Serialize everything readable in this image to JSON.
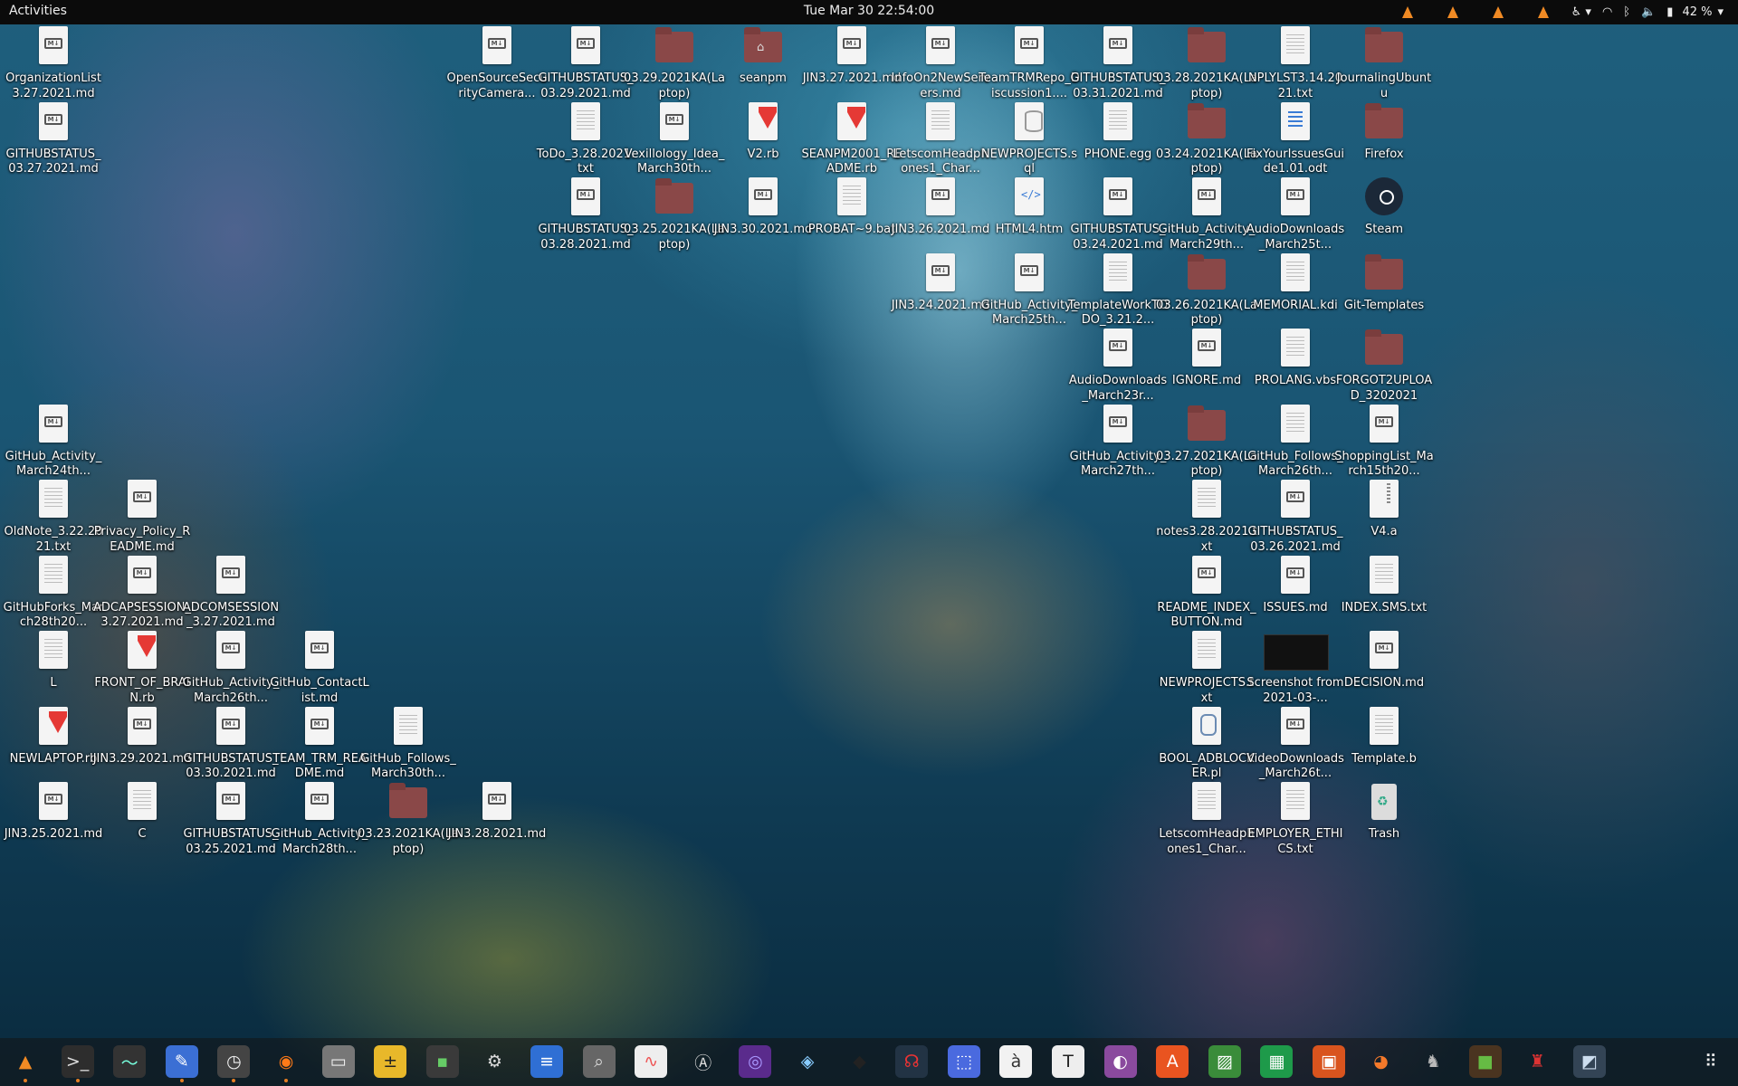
{
  "topbar": {
    "activities": "Activities",
    "clock": "Tue Mar 30  22:54:00",
    "battery": "42 %"
  },
  "icons": [
    {
      "label": "OrganizationList3.27.2021.md",
      "type": "md",
      "col": 0,
      "row": 0
    },
    {
      "label": "GITHUBSTATUS_03.27.2021.md",
      "type": "md",
      "col": 0,
      "row": 1
    },
    {
      "label": "GitHub_Activity_March24th...",
      "type": "md",
      "col": 0,
      "row": 5
    },
    {
      "label": "OldNote_3.22.2021.txt",
      "type": "txt",
      "col": 0,
      "row": 6
    },
    {
      "label": "GitHubForks_March28th20...",
      "type": "txt",
      "col": 0,
      "row": 7
    },
    {
      "label": "L",
      "type": "txt",
      "col": 0,
      "row": 8
    },
    {
      "label": "NEWLAPTOP.rb",
      "type": "rb",
      "col": 0,
      "row": 9
    },
    {
      "label": "JIN3.25.2021.md",
      "type": "md",
      "col": 0,
      "row": 10
    },
    {
      "label": "Privacy_Policy_README.md",
      "type": "md",
      "col": 1,
      "row": 6
    },
    {
      "label": "ADCAPSESSION_3.27.2021.md",
      "type": "md",
      "col": 1,
      "row": 7
    },
    {
      "label": "FRONT_OF_BRAIN.rb",
      "type": "rb",
      "col": 1,
      "row": 8
    },
    {
      "label": "JIN3.29.2021.md",
      "type": "md",
      "col": 1,
      "row": 9
    },
    {
      "label": "C",
      "type": "txt",
      "col": 1,
      "row": 10
    },
    {
      "label": "ADCOMSESSION_3.27.2021.md",
      "type": "md",
      "col": 2,
      "row": 7
    },
    {
      "label": "GitHub_Activity_March26th...",
      "type": "md",
      "col": 2,
      "row": 8
    },
    {
      "label": "GITHUBSTATUS_03.30.2021.md",
      "type": "md",
      "col": 2,
      "row": 9
    },
    {
      "label": "GITHUBSTATUS_03.25.2021.md",
      "type": "md",
      "col": 2,
      "row": 10
    },
    {
      "label": "GitHub_ContactList.md",
      "type": "md",
      "col": 3,
      "row": 8
    },
    {
      "label": "TEAM_TRM_README.md",
      "type": "md",
      "col": 3,
      "row": 9
    },
    {
      "label": "GitHub_Activity_March28th...",
      "type": "md",
      "col": 3,
      "row": 10
    },
    {
      "label": "GitHub_Follows_March30th...",
      "type": "txt",
      "col": 4,
      "row": 9
    },
    {
      "label": "03.23.2021KA(Laptop)",
      "type": "folder",
      "col": 4,
      "row": 10
    },
    {
      "label": "OpenSourceSecurityCamera...",
      "type": "md",
      "col": 5,
      "row": 0
    },
    {
      "label": "JIN3.28.2021.md",
      "type": "md",
      "col": 5,
      "row": 10
    },
    {
      "label": "GITHUBSTATUS_03.29.2021.md",
      "type": "md",
      "col": 6,
      "row": 0
    },
    {
      "label": "ToDo_3.28.2021.txt",
      "type": "txt",
      "col": 6,
      "row": 1
    },
    {
      "label": "GITHUBSTATUS_03.28.2021.md",
      "type": "md",
      "col": 6,
      "row": 2
    },
    {
      "label": "03.29.2021KA(Laptop)",
      "type": "folder",
      "col": 7,
      "row": 0
    },
    {
      "label": "Vexillology_Idea_March30th...",
      "type": "md",
      "col": 7,
      "row": 1
    },
    {
      "label": "03.25.2021KA(Laptop)",
      "type": "folder",
      "col": 7,
      "row": 2
    },
    {
      "label": "seanpm",
      "type": "home",
      "col": 8,
      "row": 0
    },
    {
      "label": "V2.rb",
      "type": "rb",
      "col": 8,
      "row": 1
    },
    {
      "label": "JIN3.30.2021.md",
      "type": "md",
      "col": 8,
      "row": 2
    },
    {
      "label": "JIN3.27.2021.md",
      "type": "md",
      "col": 9,
      "row": 0
    },
    {
      "label": "SEANPM2001_README.rb",
      "type": "rb",
      "col": 9,
      "row": 1
    },
    {
      "label": "PROBAT~9.bat",
      "type": "txt",
      "col": 9,
      "row": 2
    },
    {
      "label": "InfoOn2NewServers.md",
      "type": "md",
      "col": 10,
      "row": 0
    },
    {
      "label": "LetscomHeadphones1_Char...",
      "type": "txt",
      "col": 10,
      "row": 1
    },
    {
      "label": "JIN3.26.2021.md",
      "type": "md",
      "col": 10,
      "row": 2
    },
    {
      "label": "JIN3.24.2021.md",
      "type": "md",
      "col": 10,
      "row": 3
    },
    {
      "label": "TeamTRMRepo_Discussion1....",
      "type": "md",
      "col": 11,
      "row": 0
    },
    {
      "label": "NEWPROJECTS.sql",
      "type": "sql",
      "col": 11,
      "row": 1
    },
    {
      "label": "HTML4.htm",
      "type": "html",
      "col": 11,
      "row": 2
    },
    {
      "label": "GitHub_Activity_March25th...",
      "type": "md",
      "col": 11,
      "row": 3
    },
    {
      "label": "GITHUBSTATUS_03.31.2021.md",
      "type": "md",
      "col": 12,
      "row": 0
    },
    {
      "label": "PHONE.egg",
      "type": "txt",
      "col": 12,
      "row": 1
    },
    {
      "label": "GITHUBSTATUS_03.24.2021.md",
      "type": "md",
      "col": 12,
      "row": 2
    },
    {
      "label": "TemplateWorkTODO_3.21.2...",
      "type": "txt",
      "col": 12,
      "row": 3
    },
    {
      "label": "AudioDownloads_March23r...",
      "type": "md",
      "col": 12,
      "row": 4
    },
    {
      "label": "GitHub_Activity_March27th...",
      "type": "md",
      "col": 12,
      "row": 5
    },
    {
      "label": "03.28.2021KA(Laptop)",
      "type": "folder",
      "col": 13,
      "row": 0
    },
    {
      "label": "03.24.2021KA(Laptop)",
      "type": "folder",
      "col": 13,
      "row": 1
    },
    {
      "label": "GitHub_Activity_March29th...",
      "type": "md",
      "col": 13,
      "row": 2
    },
    {
      "label": "03.26.2021KA(Laptop)",
      "type": "folder",
      "col": 13,
      "row": 3
    },
    {
      "label": "IGNORE.md",
      "type": "md",
      "col": 13,
      "row": 4
    },
    {
      "label": "03.27.2021KA(Laptop)",
      "type": "folder",
      "col": 13,
      "row": 5
    },
    {
      "label": "notes3.28.2021.txt",
      "type": "txt",
      "col": 13,
      "row": 6
    },
    {
      "label": "README_INDEX_BUTTON.md",
      "type": "md",
      "col": 13,
      "row": 7
    },
    {
      "label": "NEWPROJECTS.txt",
      "type": "txt",
      "col": 13,
      "row": 8
    },
    {
      "label": "BOOL_ADBLOCKER.pl",
      "type": "pl",
      "col": 13,
      "row": 9
    },
    {
      "label": "LetscomHeadphones1_Char...",
      "type": "txt",
      "col": 13,
      "row": 10
    },
    {
      "label": "NPLYLST3.14.2021.txt",
      "type": "txt",
      "col": 14,
      "row": 0
    },
    {
      "label": "FixYourIssuesGuide1.01.odt",
      "type": "odt",
      "col": 14,
      "row": 1
    },
    {
      "label": "AudioDownloads_March25t...",
      "type": "md",
      "col": 14,
      "row": 2
    },
    {
      "label": "MEMORIAL.kdi",
      "type": "txt",
      "col": 14,
      "row": 3
    },
    {
      "label": "PROLANG.vbs",
      "type": "txt",
      "col": 14,
      "row": 4
    },
    {
      "label": "GitHub_Follows_March26th...",
      "type": "txt",
      "col": 14,
      "row": 5
    },
    {
      "label": "GITHUBSTATUS_03.26.2021.md",
      "type": "md",
      "col": 14,
      "row": 6
    },
    {
      "label": "ISSUES.md",
      "type": "md",
      "col": 14,
      "row": 7
    },
    {
      "label": "Screenshot from 2021-03-...",
      "type": "shot",
      "col": 14,
      "row": 8
    },
    {
      "label": "VideoDownloads_March26t...",
      "type": "md",
      "col": 14,
      "row": 9
    },
    {
      "label": "EMPLOYER_ETHICS.txt",
      "type": "txt",
      "col": 14,
      "row": 10
    },
    {
      "label": "JournalingUbuntu",
      "type": "folder",
      "col": 15,
      "row": 0
    },
    {
      "label": "Firefox",
      "type": "folder",
      "col": 15,
      "row": 1
    },
    {
      "label": "Steam",
      "type": "steam",
      "col": 15,
      "row": 2
    },
    {
      "label": "Git-Templates",
      "type": "folder",
      "col": 15,
      "row": 3
    },
    {
      "label": "FORGOT2UPLOAD_3202021",
      "type": "folder",
      "col": 15,
      "row": 4
    },
    {
      "label": "ShoppingList_March15th20...",
      "type": "md",
      "col": 15,
      "row": 5
    },
    {
      "label": "V4.a",
      "type": "zip",
      "col": 15,
      "row": 6
    },
    {
      "label": "INDEX.SMS.txt",
      "type": "txt",
      "col": 15,
      "row": 7
    },
    {
      "label": "DECISION.md",
      "type": "md",
      "col": 15,
      "row": 8
    },
    {
      "label": "Template.b",
      "type": "txt",
      "col": 15,
      "row": 9
    },
    {
      "label": "Trash",
      "type": "trash",
      "col": 15,
      "row": 10
    }
  ],
  "dock": [
    {
      "name": "vlc-icon",
      "glyph": "▲",
      "color": "#f08a24",
      "bg": "transparent",
      "running": true
    },
    {
      "name": "terminal-icon",
      "glyph": ">_",
      "color": "#ddd",
      "bg": "#2d2d2d",
      "running": true
    },
    {
      "name": "system-monitor-icon",
      "glyph": "〜",
      "color": "#7fd",
      "bg": "#333",
      "running": false
    },
    {
      "name": "text-editor-icon",
      "glyph": "✎",
      "color": "#fff",
      "bg": "#3b6fd4",
      "running": true
    },
    {
      "name": "clock-icon",
      "glyph": "◷",
      "color": "#eee",
      "bg": "#444",
      "running": true
    },
    {
      "name": "firefox-icon",
      "glyph": "◉",
      "color": "#ff7a18",
      "bg": "transparent",
      "running": true
    },
    {
      "name": "files-icon",
      "glyph": "▭",
      "color": "#eee",
      "bg": "#777",
      "running": false
    },
    {
      "name": "calculator-icon",
      "glyph": "±",
      "color": "#222",
      "bg": "#e8b82a",
      "running": false
    },
    {
      "name": "gnome-terminal-green-icon",
      "glyph": "▪",
      "color": "#6c6",
      "bg": "#3a3a3a",
      "running": false
    },
    {
      "name": "settings-icon",
      "glyph": "⚙",
      "color": "#ddd",
      "bg": "transparent",
      "running": false
    },
    {
      "name": "writer-icon",
      "glyph": "≡",
      "color": "#fff",
      "bg": "#2f6fd4",
      "running": false
    },
    {
      "name": "image-viewer-icon",
      "glyph": "⌕",
      "color": "#ddd",
      "bg": "#666",
      "running": false
    },
    {
      "name": "sound-recorder-icon",
      "glyph": "∿",
      "color": "#e55",
      "bg": "#eee",
      "running": false
    },
    {
      "name": "software-updater-icon",
      "glyph": "Ⓐ",
      "color": "#ddd",
      "bg": "transparent",
      "running": false
    },
    {
      "name": "cheese-icon",
      "glyph": "◎",
      "color": "#a9f",
      "bg": "#5a2b8c",
      "running": false
    },
    {
      "name": "virtualbox-icon",
      "glyph": "◈",
      "color": "#8cf",
      "bg": "transparent",
      "running": false
    },
    {
      "name": "inkscape-icon",
      "glyph": "◆",
      "color": "#222",
      "bg": "transparent",
      "running": false
    },
    {
      "name": "headphones-icon",
      "glyph": "☊",
      "color": "#e33",
      "bg": "#234",
      "running": false
    },
    {
      "name": "screenshot-icon",
      "glyph": "⬚",
      "color": "#fff",
      "bg": "#4a6adf",
      "running": false
    },
    {
      "name": "character-map-icon",
      "glyph": "à",
      "color": "#333",
      "bg": "#f2f2f2",
      "running": false
    },
    {
      "name": "typora-icon",
      "glyph": "T",
      "color": "#222",
      "bg": "#eee",
      "running": false
    },
    {
      "name": "tweaks-icon",
      "glyph": "◐",
      "color": "#fff",
      "bg": "#8a4a9e",
      "running": false
    },
    {
      "name": "software-center-icon",
      "glyph": "A",
      "color": "#fff",
      "bg": "#e95420",
      "running": false
    },
    {
      "name": "shotwell-icon",
      "glyph": "▨",
      "color": "#fff",
      "bg": "#3a8c3a",
      "running": false
    },
    {
      "name": "calc-icon",
      "glyph": "▦",
      "color": "#fff",
      "bg": "#1e9a4a",
      "running": false
    },
    {
      "name": "impress-icon",
      "glyph": "▣",
      "color": "#fff",
      "bg": "#d9541e",
      "running": false
    },
    {
      "name": "blender-icon",
      "glyph": "◕",
      "color": "#f5792a",
      "bg": "transparent",
      "running": false
    },
    {
      "name": "gimp-icon",
      "glyph": "♞",
      "color": "#bbb",
      "bg": "transparent",
      "running": false
    },
    {
      "name": "minecraft-icon",
      "glyph": "■",
      "color": "#6b4",
      "bg": "#4a3420",
      "running": false
    },
    {
      "name": "game-character-icon",
      "glyph": "♜",
      "color": "#d33",
      "bg": "transparent",
      "running": false
    },
    {
      "name": "disk-icon",
      "glyph": "◩",
      "color": "#cde",
      "bg": "#345",
      "running": false
    }
  ],
  "dock_apps_grid": "show-applications-icon"
}
